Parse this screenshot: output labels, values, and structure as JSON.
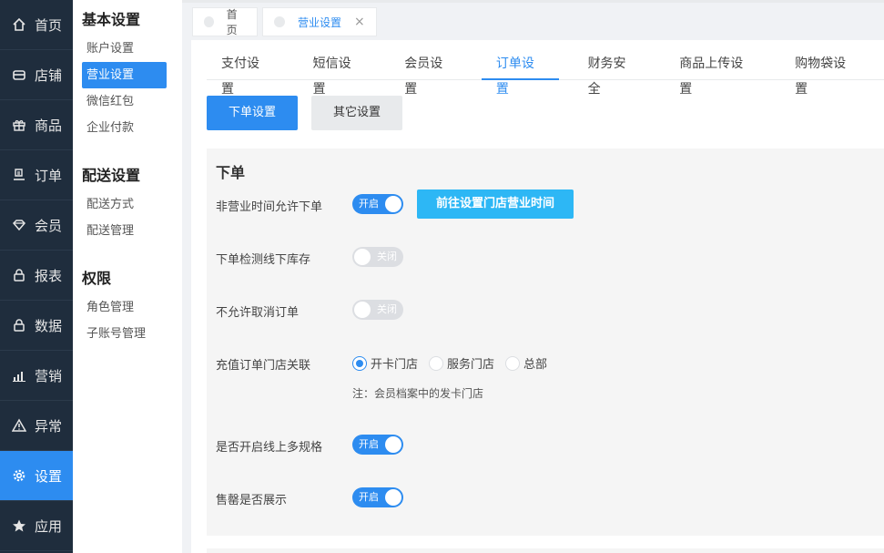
{
  "nav": {
    "items": [
      {
        "label": "首页",
        "icon": "home-icon"
      },
      {
        "label": "店铺",
        "icon": "store-icon"
      },
      {
        "label": "商品",
        "icon": "gift-icon"
      },
      {
        "label": "订单",
        "icon": "order-icon"
      },
      {
        "label": "会员",
        "icon": "diamond-icon"
      },
      {
        "label": "报表",
        "icon": "lock-icon"
      },
      {
        "label": "数据",
        "icon": "lock-icon"
      },
      {
        "label": "营销",
        "icon": "bar-chart-icon"
      },
      {
        "label": "异常",
        "icon": "warning-icon"
      },
      {
        "label": "设置",
        "icon": "gear-icon"
      },
      {
        "label": "应用",
        "icon": "star-icon"
      }
    ],
    "active_index": 9
  },
  "submenu": {
    "groups": [
      {
        "title": "基本设置",
        "items": [
          "账户设置",
          "营业设置",
          "微信红包",
          "企业付款"
        ]
      },
      {
        "title": "配送设置",
        "items": [
          "配送方式",
          "配送管理"
        ]
      },
      {
        "title": "权限",
        "items": [
          "角色管理",
          "子账号管理"
        ]
      }
    ],
    "active_item": "营业设置"
  },
  "page_tabs": [
    {
      "label": "首页"
    },
    {
      "label": "营业设置",
      "close": "×"
    }
  ],
  "setting_tabs": [
    "支付设置",
    "短信设置",
    "会员设置",
    "订单设置",
    "财务安全",
    "商品上传设置",
    "购物袋设置"
  ],
  "active_setting_tab": "订单设置",
  "buttons": {
    "primary": "下单设置",
    "secondary": "其它设置"
  },
  "section": {
    "title": "下单",
    "rows": {
      "non_business_order": {
        "label": "非营业时间允许下单",
        "state": "开启",
        "link": "前往设置门店营业时间"
      },
      "stock_check": {
        "label": "下单检测线下库存",
        "state": "关闭"
      },
      "cancel_order": {
        "label": "不允许取消订单",
        "state": "关闭"
      },
      "recharge_store": {
        "label": "充值订单门店关联",
        "options": [
          "开卡门店",
          "服务门店",
          "总部"
        ],
        "selected": "开卡门店",
        "note": "注：会员档案中的发卡门店"
      },
      "multi_spec": {
        "label": "是否开启线上多规格",
        "state": "开启"
      },
      "sold_out": {
        "label": "售罄是否展示",
        "state": "开启"
      }
    }
  },
  "colors": {
    "nav_bg": "#1f2d3d",
    "accent": "#2d8cf0",
    "cyan": "#2db7f5"
  }
}
